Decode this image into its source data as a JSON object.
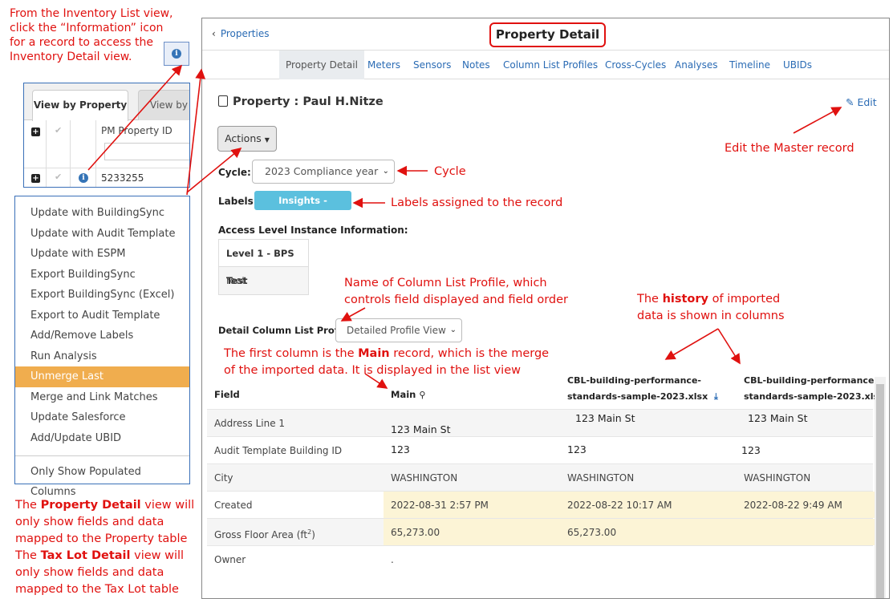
{
  "annotations": {
    "inventory_note": [
      "From the Inventory List view,",
      "click the “Information” icon",
      "for a record to access the",
      "Inventory Detail view."
    ],
    "edit_note": "Edit the Master record",
    "cycle_note": "Cycle",
    "labels_note": "Labels assigned to the record",
    "column_profile_note": [
      "Name of Column List Profile, which",
      "controls field displayed and field order"
    ],
    "history_note_pre": "The ",
    "history_note_bold": "history",
    "history_note_post": " of imported",
    "history_note_line2": "data is shown in columns",
    "main_note_pre": "The first column is the ",
    "main_note_bold": "Main",
    "main_note_post": " record, which is the merge",
    "main_note_line2": "of the imported data. It is displayed in the list view",
    "bottom_notes": {
      "l1_pre": "The ",
      "l1_bold": "Property Detail",
      "l1_post": " view will",
      "l2": "only show fields and data",
      "l3": "mapped to the Property table",
      "l4_pre": "The ",
      "l4_bold": "Tax Lot Detail",
      "l4_post": " view will",
      "l5": "only show fields and data",
      "l6": "mapped to the Tax Lot table"
    }
  },
  "inventory_grid": {
    "tab_active": "View by Property",
    "tab_inactive": "View by",
    "column_header": "PM Property ID",
    "row_value": "5233255"
  },
  "actions_menu": {
    "items": [
      "Update with BuildingSync",
      "Update with Audit Template",
      "Update with ESPM",
      "Export BuildingSync",
      "Export BuildingSync (Excel)",
      "Export to Audit Template",
      "Add/Remove Labels",
      "Run Analysis",
      "Unmerge Last",
      "Merge and Link Matches",
      "Update Salesforce",
      "Add/Update UBID"
    ],
    "highlighted": "Unmerge Last",
    "footer_item": "Only Show Populated Columns"
  },
  "window": {
    "back_label": "Properties",
    "title": "Property Detail",
    "nav_tabs": [
      "Property Detail",
      "Meters",
      "Sensors",
      "Notes",
      "Column List Profiles",
      "Cross-Cycles",
      "Analyses",
      "Timeline",
      "UBIDs"
    ],
    "active_tab": "Property Detail",
    "heading": "Property : Paul H.Nitze",
    "edit_label": "Edit",
    "actions_button": "Actions",
    "cycle_label": "Cycle:",
    "cycle_value": "2023 Compliance year",
    "labels_label": "Labels:",
    "label_badge": "Insights - Compliant",
    "label_color": "#5bc0de",
    "access_level_title": "Access Level Instance Information:",
    "access_level_header": "Level 1 - BPS Test",
    "access_level_value": "root",
    "column_profile_label": "Detail Column List Profile:",
    "column_profile_value": "Detailed Profile View"
  },
  "detail_table": {
    "headers": {
      "field": "Field",
      "main": "Main",
      "import1_line1": "CBL-building-performance-",
      "import1_line2": "standards-sample-2023.xlsx",
      "import2_line1": "CBL-building-performance-",
      "import2_line2": "standards-sample-2023.xlsx"
    },
    "rows": [
      {
        "field": "Address Line 1",
        "main": "123 Main St",
        "import1": "123 Main St",
        "import2": "123 Main St"
      },
      {
        "field": "Audit Template Building ID",
        "main": "123",
        "import1": "123",
        "import2": "123"
      },
      {
        "field": "City",
        "main": "WASHINGTON",
        "import1": "WASHINGTON",
        "import2": "WASHINGTON"
      },
      {
        "field": "Created",
        "main": "2022-08-31 2:57 PM",
        "import1": "2022-08-22 10:17 AM",
        "import2": "2022-08-22 9:49 AM"
      },
      {
        "field": "Gross Floor Area (ft",
        "field_sup": "2",
        "field_end": ")",
        "main": "65,273.00",
        "import1": "65,273.00",
        "import2": ""
      },
      {
        "field": "Owner",
        "main": ".",
        "import1": "",
        "import2": ""
      }
    ]
  },
  "colors": {
    "annotation": "#e0110f",
    "link": "#2a6bb4",
    "highlight_row": "#fcf4d6",
    "menu_highlight": "#f0ad4e"
  }
}
